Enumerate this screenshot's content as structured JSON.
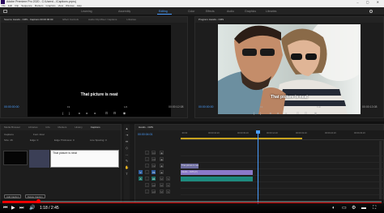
{
  "titlebar": {
    "title": "Adobe Premiere Pro 2020 - C:\\Users\\...\\Captions.prproj",
    "window_controls": "– ▢ ✕"
  },
  "menubar": [
    "File",
    "Edit",
    "Clip",
    "Sequence",
    "Markers",
    "Graphics",
    "View",
    "Window",
    "Help"
  ],
  "workspaces": {
    "items": [
      "Learning",
      "Assembly",
      "Editing",
      "Color",
      "Effects",
      "Audio",
      "Graphics",
      "Libraries"
    ],
    "active": "Editing"
  },
  "source_monitor": {
    "tabs": [
      "Source: Hands - CMS - Captions 00:00:00:00",
      "Effect Controls",
      "Audio Clip Mixer: Captions",
      "Libraries"
    ],
    "caption_text": "That picture is neat",
    "timecode_left": "00:00:00:00",
    "timecode_right": "00:00:12:08",
    "fit": "Fit",
    "page": "1/2"
  },
  "program_monitor": {
    "tabs": [
      "Program: Hands - CMS"
    ],
    "caption_text": "That picture is neat",
    "timecode_left": "00:00:00:00",
    "timecode_right": "00:00:13:08",
    "fit": "Fit",
    "page": "Full"
  },
  "effects_panel": {
    "tabs": [
      "Media Browser",
      "Libraries",
      "Info",
      "Markers",
      "History",
      "Captions"
    ],
    "header_label": "Captions",
    "font_label": "Font: Arial",
    "row_labels": [
      "Size: 46",
      "Edge: 0",
      "Edge Thickness: 0",
      "Line Spacing: 0"
    ],
    "caption_text": "That picture is neat",
    "buttons": [
      "Add Caption",
      "Delete Caption"
    ]
  },
  "timeline": {
    "tab": "Hands - CMS",
    "timecode": "00:00:04:01",
    "ruler_ticks": [
      ":00:00",
      "00:00:04:23",
      "00:00:09:23",
      "00:00:14:23",
      "00:00:19:23",
      "00:00:24:23",
      "00:00:29:23"
    ],
    "tracks": [
      {
        "name": "C1",
        "kind": "caption"
      },
      {
        "name": "V3",
        "kind": "video"
      },
      {
        "name": "V2",
        "kind": "video"
      },
      {
        "name": "V1",
        "kind": "video"
      },
      {
        "name": "A1",
        "kind": "audio"
      },
      {
        "name": "A2",
        "kind": "audio"
      },
      {
        "name": "A3",
        "kind": "audio"
      }
    ],
    "clips": {
      "caption": "That picture is neat",
      "video": "Hands - CMS [V]",
      "audio": ""
    }
  },
  "youtube_controls": {
    "time": "1:18 / 2:45",
    "progress_fraction": 0.094,
    "icons": [
      "previous-icon",
      "play-icon",
      "next-icon",
      "volume-icon",
      "settings-icon",
      "fullscreen-icon"
    ]
  },
  "colors": {
    "accent_blue": "#4a9eff",
    "caption_clip": "#6e6da0",
    "video_clip": "#8b79c9",
    "audio_clip": "#1e8a7e",
    "progress_red": "#ff0000"
  }
}
